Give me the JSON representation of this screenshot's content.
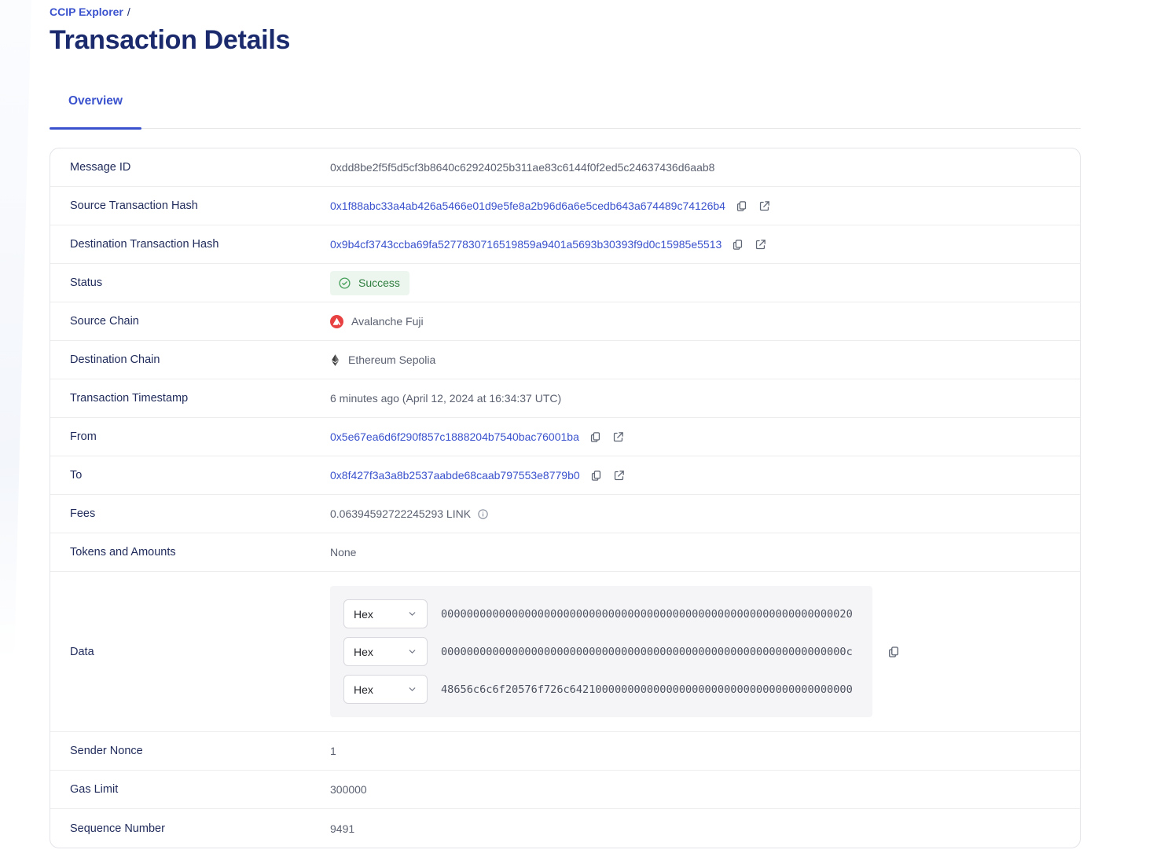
{
  "breadcrumb": {
    "link_label": "CCIP Explorer",
    "separator": "/"
  },
  "page": {
    "title": "Transaction Details"
  },
  "tabs": {
    "overview": "Overview"
  },
  "table": {
    "message_id": {
      "label": "Message ID",
      "value": "0xdd8be2f5f5d5cf3b8640c62924025b311ae83c6144f0f2ed5c24637436d6aab8"
    },
    "source_tx": {
      "label": "Source Transaction Hash",
      "value": "0x1f88abc33a4ab426a5466e01d9e5fe8a2b96d6a6e5cedb643a674489c74126b4"
    },
    "dest_tx": {
      "label": "Destination Transaction Hash",
      "value": "0x9b4cf3743ccba69fa5277830716519859a9401a5693b30393f9d0c15985e5513"
    },
    "status": {
      "label": "Status",
      "value": "Success"
    },
    "source_chain": {
      "label": "Source Chain",
      "value": "Avalanche Fuji"
    },
    "dest_chain": {
      "label": "Destination Chain",
      "value": "Ethereum Sepolia"
    },
    "timestamp": {
      "label": "Transaction Timestamp",
      "value": "6 minutes ago (April 12, 2024 at 16:34:37 UTC)"
    },
    "from": {
      "label": "From",
      "value": "0x5e67ea6d6f290f857c1888204b7540bac76001ba"
    },
    "to": {
      "label": "To",
      "value": "0x8f427f3a3a8b2537aabde68caab797553e8779b0"
    },
    "fees": {
      "label": "Fees",
      "value": "0.06394592722245293 LINK"
    },
    "tokens": {
      "label": "Tokens and Amounts",
      "value": "None"
    },
    "data": {
      "label": "Data",
      "encoding": "Hex",
      "lines": [
        "0000000000000000000000000000000000000000000000000000000000000020",
        "000000000000000000000000000000000000000000000000000000000000000c",
        "48656c6c6f20576f726c64210000000000000000000000000000000000000000"
      ]
    },
    "sender_nonce": {
      "label": "Sender Nonce",
      "value": "1"
    },
    "gas_limit": {
      "label": "Gas Limit",
      "value": "300000"
    },
    "sequence_number": {
      "label": "Sequence Number",
      "value": "9491"
    }
  },
  "colors": {
    "accent_blue": "#3a52cd",
    "heading_navy": "#1a2a6c",
    "success_text": "#2e7d3e",
    "success_bg": "#ecf6ee",
    "avalanche_red": "#e84142",
    "ethereum_dark": "#3c3c3d"
  }
}
